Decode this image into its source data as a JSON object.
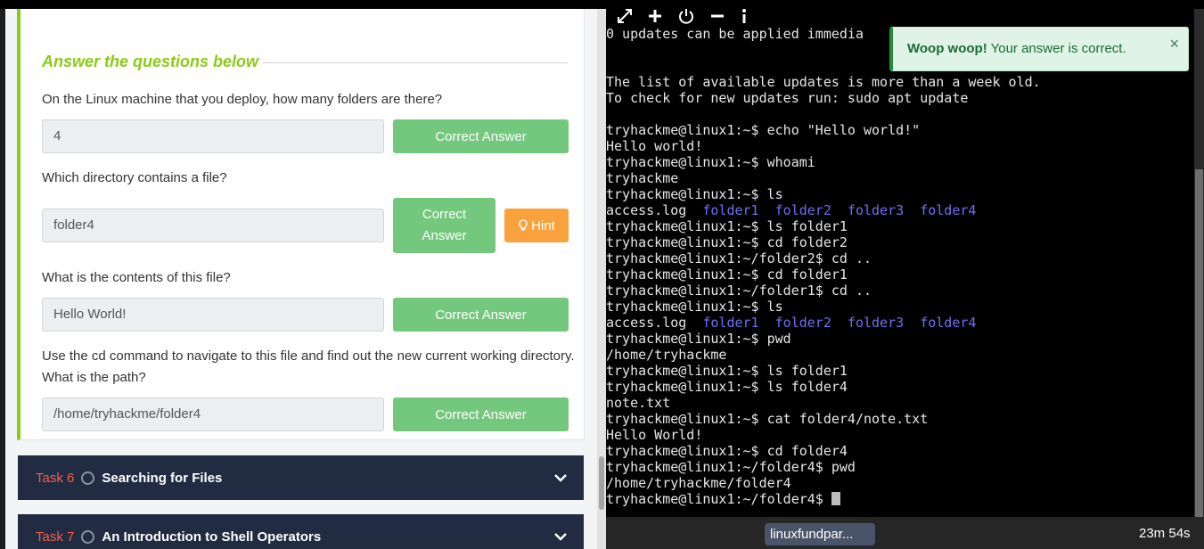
{
  "answers_section": {
    "title": "Answer the questions below",
    "questions": [
      {
        "text": "On the Linux machine that you deploy, how many folders are there?",
        "answer": "4",
        "button": "Correct Answer"
      },
      {
        "text": "Which directory contains a file?",
        "answer": "folder4",
        "button_line1": "Correct",
        "button_line2": "Answer",
        "hint": "Hint"
      },
      {
        "text": "What is the contents of this file?",
        "answer": "Hello World!",
        "button": "Correct Answer"
      },
      {
        "text": "Use the cd command to navigate to this file and find out the new current working directory. What is the path?",
        "answer": "/home/tryhackme/folder4",
        "button": "Correct Answer"
      }
    ]
  },
  "tasks": [
    {
      "number": "Task 6",
      "title": "Searching for Files"
    },
    {
      "number": "Task 7",
      "title": "An Introduction to Shell Operators"
    }
  ],
  "terminal": {
    "lines": [
      "0 updates can be applied immedia",
      "",
      "",
      "The list of available updates is more than a week old.",
      "To check for new updates run: sudo apt update",
      "",
      "tryhackme@linux1:~$ echo \"Hello world!\"",
      "Hello world!",
      "tryhackme@linux1:~$ whoami",
      "tryhackme",
      "tryhackme@linux1:~$ ls",
      "LS1",
      "tryhackme@linux1:~$ ls folder1",
      "tryhackme@linux1:~$ cd folder2",
      "tryhackme@linux1:~/folder2$ cd ..",
      "tryhackme@linux1:~$ cd folder1",
      "tryhackme@linux1:~/folder1$ cd ..",
      "tryhackme@linux1:~$ ls",
      "LS2",
      "tryhackme@linux1:~$ pwd",
      "/home/tryhackme",
      "tryhackme@linux1:~$ ls folder1",
      "tryhackme@linux1:~$ ls folder4",
      "note.txt",
      "tryhackme@linux1:~$ cat folder4/note.txt",
      "Hello World!",
      "tryhackme@linux1:~$ cd folder4",
      "tryhackme@linux1:~/folder4$ pwd",
      "/home/tryhackme/folder4"
    ],
    "ls_file": "access.log",
    "ls_dirs": [
      "folder1",
      "folder2",
      "folder3",
      "folder4"
    ],
    "last_prompt": "tryhackme@linux1:~/folder4$ "
  },
  "toast": {
    "strong": "Woop woop!",
    "message": "Your answer is correct.",
    "close": "×"
  },
  "toolbar": {
    "icons": [
      "expand-icon",
      "plus-icon",
      "power-icon",
      "minus-icon",
      "info-icon"
    ],
    "tab_label": "linuxfundpar...",
    "timer": "23m 54s"
  },
  "colors": {
    "accent": "#88cc14",
    "correct": "#74c87d",
    "hint": "#f9a23d",
    "task_bar": "#212c42",
    "dir_blue": "#6e6ef5"
  }
}
